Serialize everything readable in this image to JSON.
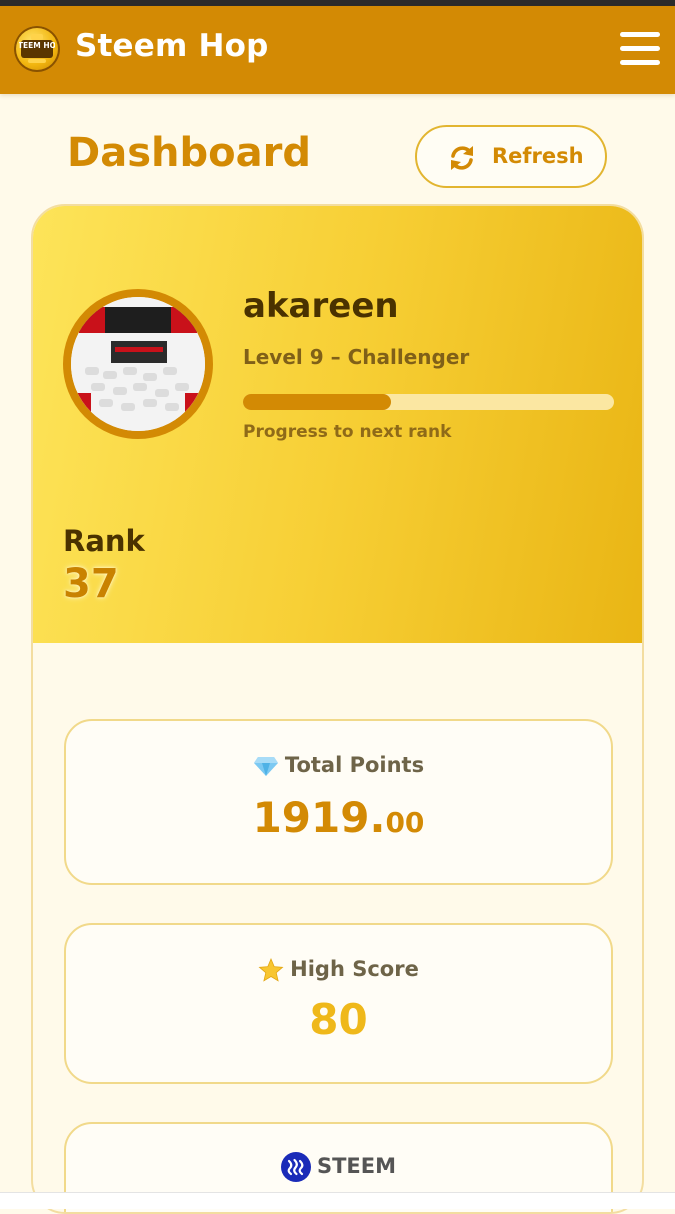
{
  "header": {
    "logo_text": "STEEM HOP",
    "logo_icon": "steem-hop-logo-icon",
    "app_title": "Steem Hop",
    "menu_icon": "hamburger-menu-icon"
  },
  "page": {
    "title": "Dashboard",
    "refresh_label": "Refresh",
    "refresh_icon": "refresh-icon"
  },
  "profile": {
    "username": "akareen",
    "level_text": "Level 9 – Challenger",
    "progress_fraction": 0.4,
    "progress_caption": "Progress to next rank",
    "rank_label": "Rank",
    "rank_value": "37",
    "avatar_icon": "avatar-photo"
  },
  "stats": {
    "total_points": {
      "icon": "diamond-icon",
      "label": "Total Points",
      "value_int": "1919.",
      "value_dec": "00"
    },
    "high_score": {
      "icon": "star-icon",
      "label": "High Score",
      "value": "80"
    },
    "steem": {
      "icon": "steem-logo-icon",
      "label": "STEEM"
    }
  },
  "colors": {
    "header_bg": "#d38a04",
    "accent": "#d38a04",
    "hero_start": "#fde459",
    "hero_end": "#e9b514",
    "score_color": "#efb81a"
  }
}
